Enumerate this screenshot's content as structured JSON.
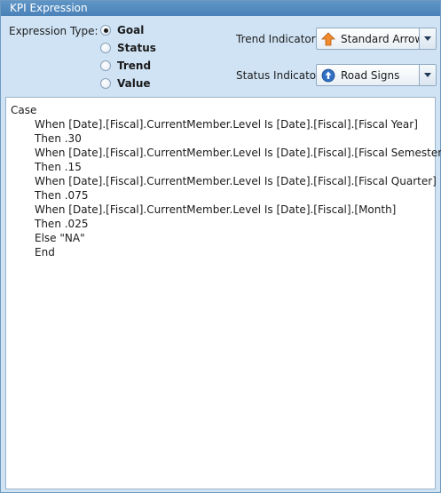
{
  "window": {
    "title": "KPI Expression"
  },
  "expression_type": {
    "label": "Expression Type:",
    "options": [
      {
        "label": "Goal",
        "selected": true
      },
      {
        "label": "Status",
        "selected": false
      },
      {
        "label": "Trend",
        "selected": false
      },
      {
        "label": "Value",
        "selected": false
      }
    ]
  },
  "trend_indicator": {
    "label": "Trend Indicator:",
    "value": "Standard Arrow",
    "icon": "orange-up-arrow-icon"
  },
  "status_indicator": {
    "label": "Status Indicator:",
    "value": "Road Signs",
    "icon": "blue-circle-arrow-icon"
  },
  "editor": {
    "lines": [
      {
        "text": "Case",
        "indent": false
      },
      {
        "text": "When [Date].[Fiscal].CurrentMember.Level Is [Date].[Fiscal].[Fiscal Year]",
        "indent": true
      },
      {
        "text": "Then .30",
        "indent": true
      },
      {
        "text": "When [Date].[Fiscal].CurrentMember.Level Is [Date].[Fiscal].[Fiscal Semester]",
        "indent": true
      },
      {
        "text": "Then .15",
        "indent": true
      },
      {
        "text": "When [Date].[Fiscal].CurrentMember.Level Is [Date].[Fiscal].[Fiscal Quarter]",
        "indent": true
      },
      {
        "text": "Then .075",
        "indent": true
      },
      {
        "text": "When [Date].[Fiscal].CurrentMember.Level Is [Date].[Fiscal].[Month]",
        "indent": true
      },
      {
        "text": "Then .025",
        "indent": true
      },
      {
        "text": "Else \"NA\"",
        "indent": true
      },
      {
        "text": "End",
        "indent": true
      }
    ]
  }
}
